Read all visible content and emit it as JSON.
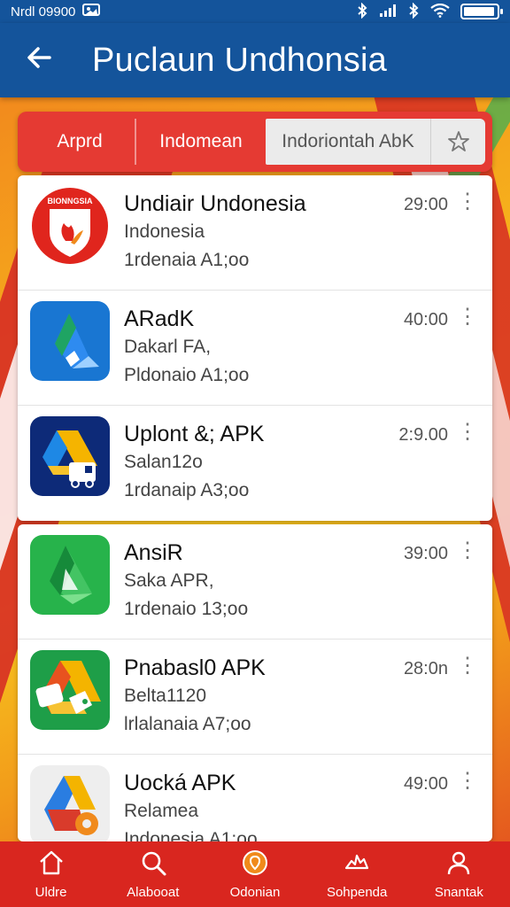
{
  "status": {
    "left": "Nrdl 09900",
    "icons": [
      "bluetooth-icon",
      "signal-icon",
      "wifi-icon",
      "battery-icon"
    ]
  },
  "appbar": {
    "title": "Puclaun Undhonsia"
  },
  "tabs": [
    "Arprd",
    "Indomean",
    "Indoriontah AbK"
  ],
  "list1": [
    {
      "name": "Undiair Undonesia",
      "sub": "Indonesia",
      "meta": "1rdenaia A1;oo",
      "time": "29:00",
      "badge": "BIONNGSIA"
    },
    {
      "name": "ARadK",
      "sub": "Dakarl FA,",
      "meta": "Pldonaio A1;oo",
      "time": "40:00"
    },
    {
      "name": "Uplont &; APK",
      "sub": "Salan12o",
      "meta": "1rdanaip A3;oo",
      "time": "2:9.00"
    }
  ],
  "list2": [
    {
      "name": "AnsiR",
      "sub": "Saka APR,",
      "meta": "1rdenaio 13;oo",
      "time": "39:00"
    },
    {
      "name": "Pnabasl0 APK",
      "sub": "Belta1120",
      "meta": "lrlalanaia A7;oo",
      "time": "28:0n"
    },
    {
      "name": "Uocká APK",
      "sub": "Relamea",
      "meta": "Indonesia A1;oo",
      "time": "49:00"
    }
  ],
  "nav": [
    {
      "label": "Uldre",
      "icon": "home-icon"
    },
    {
      "label": "Alabooat",
      "icon": "search-icon"
    },
    {
      "label": "Odonian",
      "icon": "location-icon"
    },
    {
      "label": "Sohpenda",
      "icon": "share-icon"
    },
    {
      "label": "Snantak",
      "icon": "profile-icon"
    }
  ],
  "colors": {
    "appbar": "#14549b",
    "accent_red": "#e53a33",
    "nav_red": "#d9261f"
  }
}
